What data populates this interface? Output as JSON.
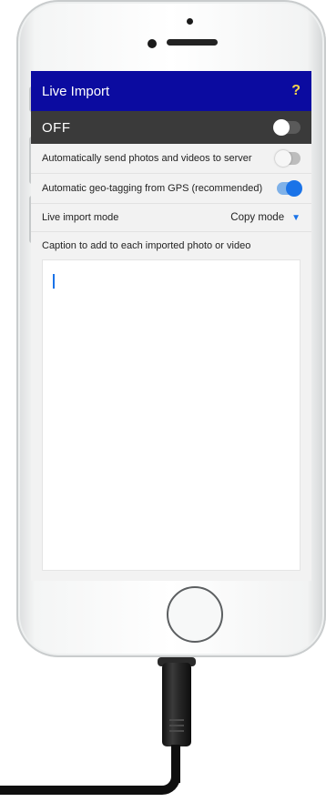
{
  "app": {
    "title": "Live Import",
    "help_label": "?"
  },
  "master_switch": {
    "label": "OFF",
    "on": false
  },
  "settings": {
    "auto_send": {
      "label": "Automatically send photos and videos to server",
      "on": false
    },
    "geo_tagging": {
      "label": "Automatic geo-tagging from GPS (recommended)",
      "on": true
    },
    "import_mode": {
      "label": "Live import mode",
      "value": "Copy mode"
    }
  },
  "caption": {
    "label": "Caption to add to each imported photo or video",
    "value": ""
  },
  "colors": {
    "title_bar": "#0b0ba0",
    "help_icon": "#f5d44c",
    "off_bar": "#3a3a3a",
    "accent": "#1a73e8"
  }
}
